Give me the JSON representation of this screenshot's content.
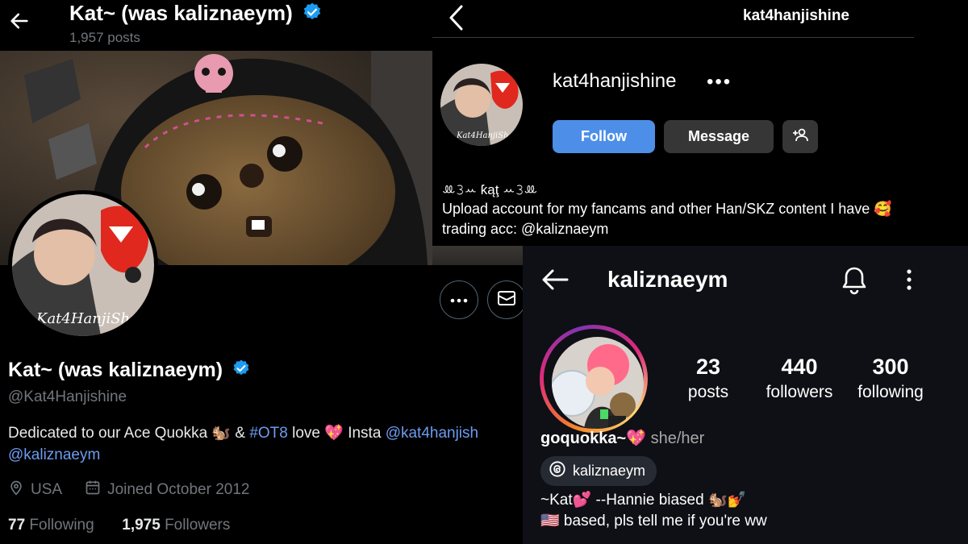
{
  "twitter": {
    "header_name": "Kat~ (was kaliznaeym)",
    "post_count": "1,957 posts",
    "display_name": "Kat~ (was kaliznaeym)",
    "handle": "@Kat4Hanjishine",
    "bio": {
      "part1": "Dedicated to our Ace Quokka 🐿️ & ",
      "hashtag": "#OT8",
      "part2": " love 💖 Insta ",
      "insta_link": "@kat4hanjish",
      "line2_link": "@kaliznaeym"
    },
    "location": "USA",
    "joined": "Joined October 2012",
    "following_count": "77",
    "following_label": "Following",
    "followers_count": "1,975",
    "followers_label": "Followers",
    "avatar_signature": "Kat4HanjiSh"
  },
  "ig_top": {
    "title": "kat4hanjishine",
    "username": "kat4hanjishine",
    "more": "•••",
    "follow_label": "Follow",
    "message_label": "Message",
    "bio_name": "ꔛ𝟹ꕀ ƙąţ ꕀ𝟹ꔛ",
    "bio_line1": "Upload account for my fancams and other Han/SKZ content I have 🥰",
    "bio_line2": "trading acc: @kaliznaeym",
    "avatar_signature": "Kat4HanjiSh"
  },
  "ig_bottom": {
    "title": "kaliznaeym",
    "stats": [
      {
        "num": "23",
        "label": "posts"
      },
      {
        "num": "440",
        "label": "followers"
      },
      {
        "num": "300",
        "label": "following"
      }
    ],
    "name": "goquokka~💖",
    "pronouns": "she/her",
    "threads_handle": "kaliznaeym",
    "bio_line1": "~Kat💕 --Hannie biased 🐿️💅",
    "bio_line2": "🇺🇸 based, pls tell me if you're ww"
  },
  "colors": {
    "verified": "#1d9bf0",
    "link": "#6c9cf0",
    "ig_follow": "#4d8fe8",
    "ig_secondary": "#363636",
    "ig2_bg": "#0e1015"
  }
}
